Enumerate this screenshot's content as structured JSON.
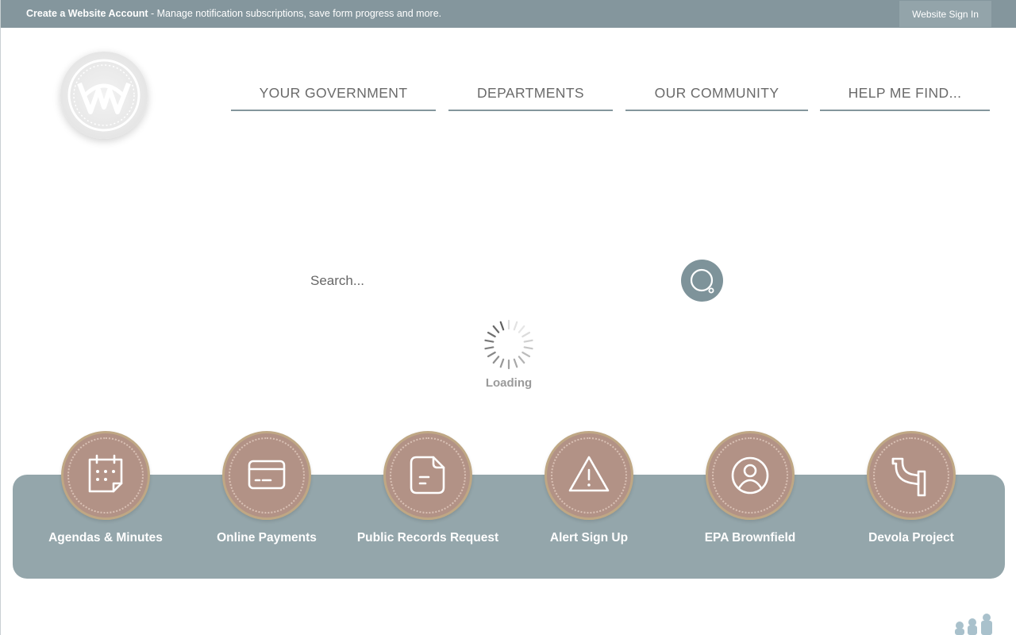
{
  "topbar": {
    "account_bold": "Create a Website Account",
    "account_rest": " - Manage notification subscriptions, save form progress and more.",
    "signin_label": "Website Sign In"
  },
  "logo": {
    "icon": "seal-logo-icon"
  },
  "nav": [
    {
      "label": "YOUR GOVERNMENT"
    },
    {
      "label": "DEPARTMENTS"
    },
    {
      "label": "OUR COMMUNITY"
    },
    {
      "label": "HELP ME FIND..."
    }
  ],
  "search": {
    "placeholder": "Search...",
    "button_icon": "search-icon"
  },
  "loading": {
    "text": "Loading"
  },
  "quick_links": [
    {
      "label": "Agendas & Minutes",
      "icon": "calendar-icon"
    },
    {
      "label": "Online Payments",
      "icon": "credit-card-icon"
    },
    {
      "label": "Public Records Request",
      "icon": "document-icon"
    },
    {
      "label": "Alert Sign Up",
      "icon": "warning-icon"
    },
    {
      "label": "EPA Brownfield",
      "icon": "user-icon"
    },
    {
      "label": "Devola Project",
      "icon": "pipe-icon"
    }
  ],
  "colors": {
    "topbar": "#84969d",
    "quick_bar": "#94a6ab",
    "quick_circle": "#b29286",
    "quick_circle_border": "#bfa784",
    "nav_underline": "#84969d"
  }
}
